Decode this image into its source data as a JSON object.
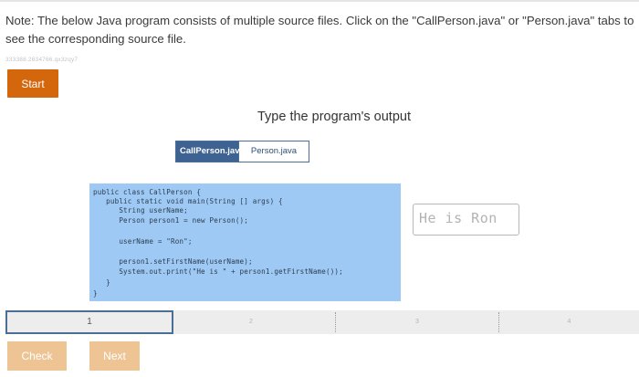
{
  "note": "Note: The below Java program consists of multiple source files. Click on the \"CallPerson.java\" or \"Person.java\" tabs to see the corresponding source file.",
  "activity_id": "333388.2634766.qx3zqy7",
  "start_label": "Start",
  "prompt": "Type the program's output",
  "tabs": [
    {
      "label": "CallPerson.java",
      "active": true
    },
    {
      "label": "Person.java",
      "active": false
    }
  ],
  "code_lines": [
    "public class CallPerson {",
    "   public static void main(String [] args) {",
    "      String userName;",
    "      Person person1 = new Person();",
    "",
    "      userName = \"Ron\";",
    "",
    "      person1.setFirstName(userName);",
    "      System.out.print(\"He is \" + person1.getFirstName());",
    "   }",
    "}"
  ],
  "answer": {
    "placeholder": "He is Ron"
  },
  "progress": {
    "current": 1,
    "segments": [
      "1",
      "2",
      "3",
      "4"
    ]
  },
  "buttons": {
    "check_label": "Check",
    "next_label": "Next"
  },
  "colors": {
    "start": "#d4670c",
    "disabled_button": "#eec495",
    "tab_active": "#3e6292",
    "code_background": "#9ec9f4"
  }
}
